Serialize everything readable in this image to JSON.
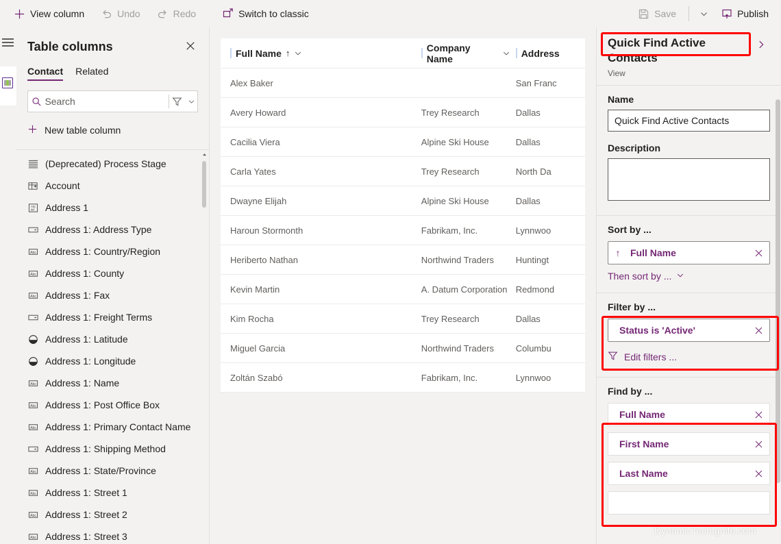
{
  "colors": {
    "accent": "#742774",
    "highlight": "#ff0000",
    "chrome": "#f3f2f1",
    "disabled": "#a19f9d"
  },
  "commandbar": {
    "view_column": "View column",
    "undo": "Undo",
    "redo": "Redo",
    "switch_to_classic": "Switch to classic",
    "save": "Save",
    "publish": "Publish"
  },
  "columns_panel": {
    "title": "Table columns",
    "tabs": [
      {
        "label": "Contact",
        "active": true
      },
      {
        "label": "Related",
        "active": false
      }
    ],
    "search": {
      "value": "",
      "placeholder": "Search"
    },
    "new_table_column": "New table column",
    "items": [
      {
        "label": "(Deprecated) Process Stage",
        "icon": "list-icon"
      },
      {
        "label": "Account",
        "icon": "lookup-icon"
      },
      {
        "label": "Address 1",
        "icon": "multiline-text-icon"
      },
      {
        "label": "Address 1: Address Type",
        "icon": "choice-icon"
      },
      {
        "label": "Address 1: Country/Region",
        "icon": "text-icon"
      },
      {
        "label": "Address 1: County",
        "icon": "text-icon"
      },
      {
        "label": "Address 1: Fax",
        "icon": "text-icon"
      },
      {
        "label": "Address 1: Freight Terms",
        "icon": "choice-icon"
      },
      {
        "label": "Address 1: Latitude",
        "icon": "decimal-icon"
      },
      {
        "label": "Address 1: Longitude",
        "icon": "decimal-icon"
      },
      {
        "label": "Address 1: Name",
        "icon": "text-icon"
      },
      {
        "label": "Address 1: Post Office Box",
        "icon": "text-icon"
      },
      {
        "label": "Address 1: Primary Contact Name",
        "icon": "text-icon"
      },
      {
        "label": "Address 1: Shipping Method",
        "icon": "choice-icon"
      },
      {
        "label": "Address 1: State/Province",
        "icon": "text-icon"
      },
      {
        "label": "Address 1: Street 1",
        "icon": "text-icon"
      },
      {
        "label": "Address 1: Street 2",
        "icon": "text-icon"
      },
      {
        "label": "Address 1: Street 3",
        "icon": "text-icon"
      }
    ]
  },
  "grid": {
    "headers": [
      {
        "label": "Full Name",
        "sorted": true,
        "sort_direction": "asc"
      },
      {
        "label": "Company Name",
        "sorted": false
      },
      {
        "label": "Address",
        "sorted": false
      }
    ],
    "rows": [
      {
        "full_name": "Alex Baker",
        "company_name": "",
        "address": "San Franc"
      },
      {
        "full_name": "Avery Howard",
        "company_name": "Trey Research",
        "address": "Dallas"
      },
      {
        "full_name": "Cacilia Viera",
        "company_name": "Alpine Ski House",
        "address": "Dallas"
      },
      {
        "full_name": "Carla Yates",
        "company_name": "Trey Research",
        "address": "North Da"
      },
      {
        "full_name": "Dwayne Elijah",
        "company_name": "Alpine Ski House",
        "address": "Dallas"
      },
      {
        "full_name": "Haroun Stormonth",
        "company_name": "Fabrikam, Inc.",
        "address": "Lynnwoo"
      },
      {
        "full_name": "Heriberto Nathan",
        "company_name": "Northwind Traders",
        "address": "Huntingt"
      },
      {
        "full_name": "Kevin Martin",
        "company_name": "A. Datum Corporation",
        "address": "Redmond"
      },
      {
        "full_name": "Kim Rocha",
        "company_name": "Trey Research",
        "address": "Dallas"
      },
      {
        "full_name": "Miguel Garcia",
        "company_name": "Northwind Traders",
        "address": "Columbu"
      },
      {
        "full_name": "Zoltán Szabó",
        "company_name": "Fabrikam, Inc.",
        "address": "Lynnwoo"
      }
    ]
  },
  "properties_panel": {
    "title": "Quick Find Active Contacts",
    "subtitle": "View",
    "name_label": "Name",
    "name_value": "Quick Find Active Contacts",
    "description_label": "Description",
    "description_value": "",
    "sort_by_label": "Sort by ...",
    "sort_chip": "Full Name",
    "sort_arrow": "↑",
    "then_sort_by": "Then sort by ...",
    "filter_by_label": "Filter by ...",
    "filter_chip": "Status is 'Active'",
    "edit_filters": "Edit filters ...",
    "find_by_label": "Find by ...",
    "find_chips": [
      "Full Name",
      "First Name",
      "Last Name"
    ]
  },
  "watermark": "DynamicTechIgnite.com"
}
